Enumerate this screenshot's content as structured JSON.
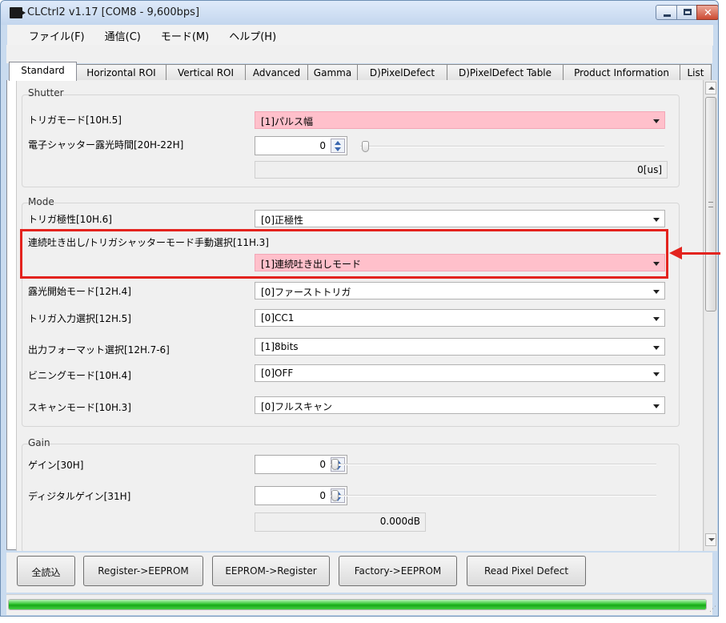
{
  "window": {
    "title": "CLCtrl2 v1.17  [COM8 - 9,600bps]"
  },
  "menu": [
    "ファイル(F)",
    "通信(C)",
    "モード(M)",
    "ヘルプ(H)"
  ],
  "tabs": [
    {
      "label": "Standard",
      "active": true
    },
    {
      "label": "Horizontal ROI"
    },
    {
      "label": "Vertical ROI"
    },
    {
      "label": "Advanced"
    },
    {
      "label": "Gamma"
    },
    {
      "label": "D)PixelDefect"
    },
    {
      "label": "D)PixelDefect Table"
    },
    {
      "label": "Product Information"
    },
    {
      "label": "List"
    }
  ],
  "shutter": {
    "title": "Shutter",
    "trigger_mode_label": "トリガモード[10H.5]",
    "trigger_mode_value": "[1]パルス幅",
    "exposure_label": "電子シャッター露光時間[20H-22H]",
    "exposure_value": "0",
    "exposure_us": "0[us]"
  },
  "mode": {
    "title": "Mode",
    "rows": [
      {
        "label": "トリガ極性[10H.6]",
        "value": "[0]正極性"
      },
      {
        "label": "連続吐き出し/トリガシャッターモード手動選択[11H.3]",
        "value": "[1]連続吐き出しモード",
        "highlight": true
      },
      {
        "label": "露光開始モード[12H.4]",
        "value": "[0]ファーストトリガ"
      },
      {
        "label": "トリガ入力選択[12H.5]",
        "value": "[0]CC1"
      },
      {
        "label": "出力フォーマット選択[12H.7-6]",
        "value": "[1]8bits"
      },
      {
        "label": "ビニングモード[10H.4]",
        "value": "[0]OFF"
      },
      {
        "label": "スキャンモード[10H.3]",
        "value": "[0]フルスキャン"
      }
    ]
  },
  "gain": {
    "title": "Gain",
    "gain_label": "ゲイン[30H]",
    "gain_value": "0",
    "digital_label": "ディジタルゲイン[31H]",
    "digital_value": "0",
    "db_readout": "0.000dB"
  },
  "buttons": [
    "全読込",
    "Register->EEPROM",
    "EEPROM->Register",
    "Factory->EEPROM",
    "Read Pixel Defect"
  ],
  "progress": {
    "fraction": 1.0
  },
  "colors": {
    "highlight_pink": "#ffc0cb",
    "annotation_red": "#e3231e",
    "progress_green": "#31c531"
  }
}
